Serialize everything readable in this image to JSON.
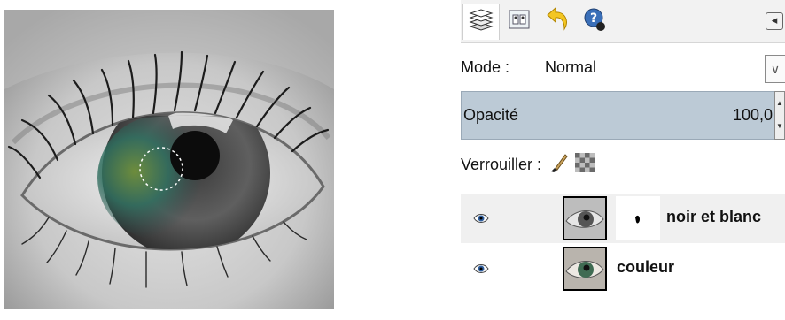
{
  "toolbar": {
    "tabs": [
      {
        "icon": "layers-icon",
        "active": true
      },
      {
        "icon": "channels-icon",
        "active": false
      },
      {
        "icon": "undo-history-icon",
        "active": false
      },
      {
        "icon": "help-icon",
        "active": false
      }
    ],
    "menu_icon": "tab-menu-icon"
  },
  "mode": {
    "label": "Mode :",
    "value": "Normal"
  },
  "opacity": {
    "label": "Opacité",
    "value": "100,0"
  },
  "lock": {
    "label": "Verrouiller :",
    "icons": [
      "lock-pixels-brush-icon",
      "lock-alpha-checker-icon"
    ]
  },
  "layers": [
    {
      "name": "noir et blanc",
      "visible": true,
      "has_mask": true,
      "thumb": "grayscale eye"
    },
    {
      "name": "couleur",
      "visible": true,
      "has_mask": false,
      "thumb": "color eye"
    }
  ],
  "colors": {
    "opacity_bar": "#bccad6",
    "selected_row": "#f0f0f0",
    "iris_color": "#3f6b52"
  }
}
